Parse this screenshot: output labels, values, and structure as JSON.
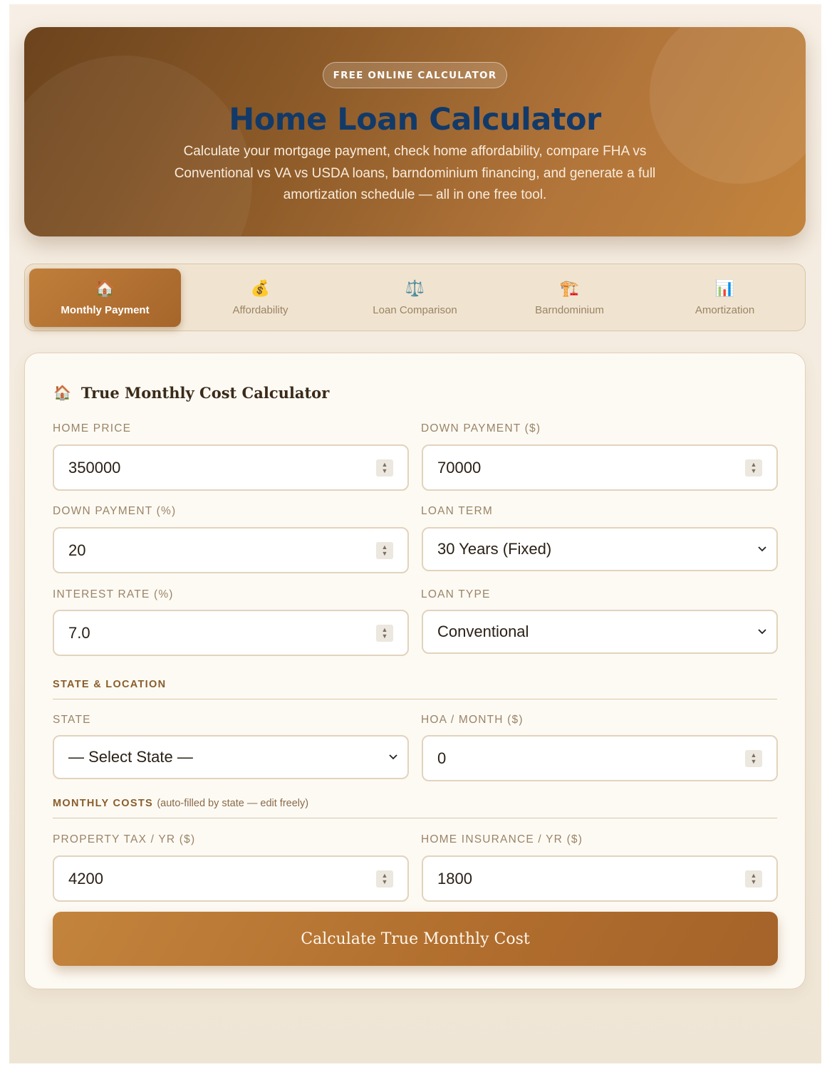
{
  "hero": {
    "badge": "FREE ONLINE CALCULATOR",
    "title": "Home Loan Calculator",
    "subtitle": "Calculate your mortgage payment, check home affordability, compare FHA vs Conventional vs VA vs USDA loans, barndominium financing, and generate a full amortization schedule — all in one free tool."
  },
  "tabs": [
    {
      "label": "Monthly Payment",
      "icon": "house-icon",
      "glyph": "🏠",
      "active": true
    },
    {
      "label": "Affordability",
      "icon": "money-bag-icon",
      "glyph": "💰",
      "active": false
    },
    {
      "label": "Loan Comparison",
      "icon": "scales-icon",
      "glyph": "⚖️",
      "active": false
    },
    {
      "label": "Barndominium",
      "icon": "crane-icon",
      "glyph": "🏗️",
      "active": false
    },
    {
      "label": "Amortization",
      "icon": "bar-chart-icon",
      "glyph": "📊",
      "active": false
    }
  ],
  "card": {
    "icon_glyph": "🏠",
    "title": "True Monthly Cost Calculator"
  },
  "form": {
    "home_price": {
      "label": "HOME PRICE",
      "value": "350000"
    },
    "down_payment_amount": {
      "label": "DOWN PAYMENT ($)",
      "value": "70000"
    },
    "down_payment_percent": {
      "label": "DOWN PAYMENT (%)",
      "value": "20"
    },
    "loan_term": {
      "label": "LOAN TERM",
      "value": "30 Years (Fixed)"
    },
    "interest_rate": {
      "label": "INTEREST RATE (%)",
      "value": "7.0"
    },
    "loan_type": {
      "label": "LOAN TYPE",
      "value": "Conventional"
    },
    "state_section": "STATE & LOCATION",
    "state": {
      "label": "STATE",
      "value": "— Select State —"
    },
    "hoa": {
      "label": "HOA / MONTH ($)",
      "value": "0"
    },
    "monthly_section": "MONTHLY COSTS",
    "monthly_note": "(auto-filled by state — edit freely)",
    "property_tax": {
      "label": "PROPERTY TAX / YR ($)",
      "value": "4200"
    },
    "home_insurance": {
      "label": "HOME INSURANCE / YR ($)",
      "value": "1800"
    }
  },
  "calculate_button": "Calculate True Monthly Cost",
  "colors": {
    "accent": "#b97533",
    "hero_title": "#123a69",
    "card_bg": "#fdfaf4",
    "page_bg": "#f3eadb"
  }
}
